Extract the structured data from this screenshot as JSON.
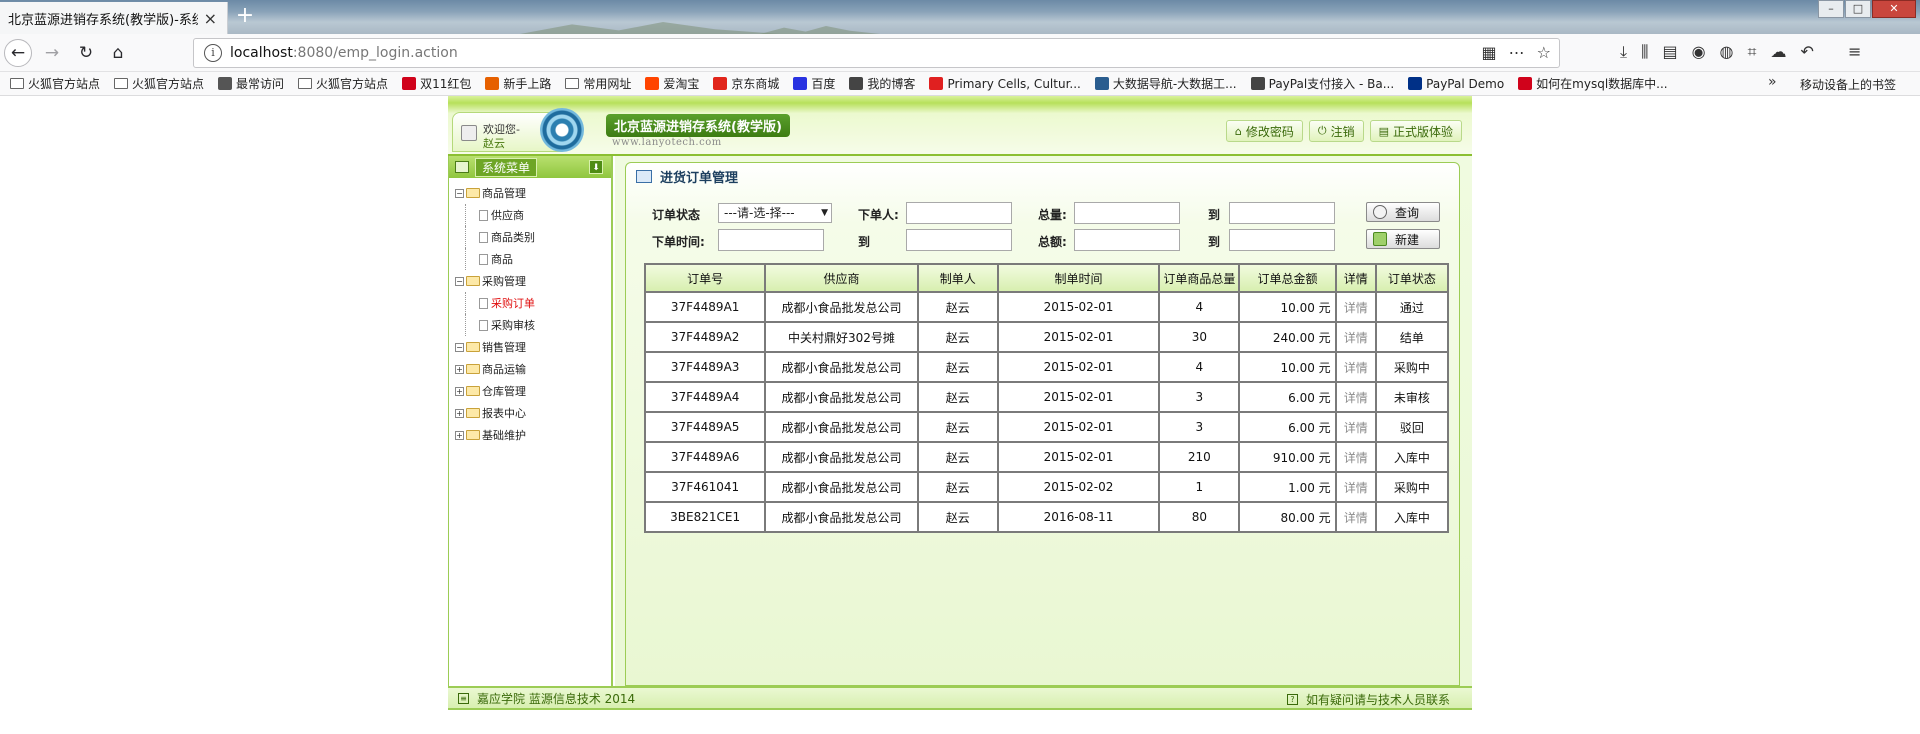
{
  "browser": {
    "tab_title": "北京蓝源进销存系统(教学版)-系统",
    "url_host": "localhost",
    "url_path": ":8080/emp_login.action",
    "bookmarks": [
      {
        "label": "火狐官方站点",
        "icon": "folder",
        "color": "#ffffff"
      },
      {
        "label": "火狐官方站点",
        "icon": "folder",
        "color": "#ffffff"
      },
      {
        "label": "最常访问",
        "icon": "gear",
        "color": "#555555"
      },
      {
        "label": "火狐官方站点",
        "icon": "folder",
        "color": "#ffffff"
      },
      {
        "label": "双11红包",
        "icon": "tmall",
        "color": "#d0021b"
      },
      {
        "label": "新手上路",
        "icon": "firefox",
        "color": "#e66000"
      },
      {
        "label": "常用网址",
        "icon": "folder",
        "color": "#ffffff"
      },
      {
        "label": "爱淘宝",
        "icon": "taobao",
        "color": "#ff4400"
      },
      {
        "label": "京东商城",
        "icon": "jd",
        "color": "#e1251b"
      },
      {
        "label": "百度",
        "icon": "baidu",
        "color": "#2932e1"
      },
      {
        "label": "我的博客",
        "icon": "blog",
        "color": "#444444"
      },
      {
        "label": "Primary Cells, Cultur...",
        "icon": "circle",
        "color": "#e02020"
      },
      {
        "label": "大数据导航-大数据工...",
        "icon": "bigdata",
        "color": "#2a5d8f"
      },
      {
        "label": "PayPal支付接入 - Ba...",
        "icon": "blog",
        "color": "#444444"
      },
      {
        "label": "PayPal Demo",
        "icon": "paypal",
        "color": "#003087"
      },
      {
        "label": "如何在mysql数据库中...",
        "icon": "csdn",
        "color": "#d0021b"
      }
    ],
    "mobile_bookmarks": "移动设备上的书签"
  },
  "header": {
    "welcome": "欢迎您-",
    "user": "赵云",
    "system_title": "北京蓝源进销存系统(教学版)",
    "site_url": "www.lanyotech.com",
    "buttons": [
      {
        "label": "修改密码",
        "icon": "home-icon"
      },
      {
        "label": "注销",
        "icon": "power-icon"
      },
      {
        "label": "正式版体验",
        "icon": "list-icon"
      }
    ]
  },
  "sidebar": {
    "title": "系统菜单",
    "groups": [
      {
        "label": "商品管理",
        "expanded": true,
        "children": [
          "供应商",
          "商品类别",
          "商品"
        ]
      },
      {
        "label": "采购管理",
        "expanded": true,
        "children": [
          "采购订单",
          "采购审核"
        ]
      },
      {
        "label": "销售管理",
        "expanded": true,
        "children": []
      },
      {
        "label": "商品运输",
        "expanded": false,
        "children": []
      },
      {
        "label": "仓库管理",
        "expanded": false,
        "children": []
      },
      {
        "label": "报表中心",
        "expanded": false,
        "children": []
      },
      {
        "label": "基础维护",
        "expanded": false,
        "children": []
      }
    ],
    "active_item": "采购订单"
  },
  "panel": {
    "title": "进货订单管理",
    "filters": {
      "status_label": "订单状态",
      "status_value": "---请-选-择---",
      "creator_label": "下单人:",
      "total_qty_label": "总量:",
      "to_label": "到",
      "date_label": "下单时间:",
      "amount_label": "总额:",
      "creator_value": "",
      "date_from": "",
      "date_to": "",
      "qty_from": "",
      "qty_to": "",
      "amount_from": "",
      "amount_to": ""
    },
    "search_button": "查询",
    "new_button": "新建"
  },
  "table": {
    "columns": [
      "订单号",
      "供应商",
      "制单人",
      "制单时间",
      "订单商品总量",
      "订单总金额",
      "详情",
      "订单状态"
    ],
    "rows": [
      [
        "37F4489A1",
        "成都小食品批发总公司",
        "赵云",
        "2015-02-01",
        "4",
        "10.00 元",
        "详情",
        "通过"
      ],
      [
        "37F4489A2",
        "中关村鼎好302号摊",
        "赵云",
        "2015-02-01",
        "30",
        "240.00 元",
        "详情",
        "结单"
      ],
      [
        "37F4489A3",
        "成都小食品批发总公司",
        "赵云",
        "2015-02-01",
        "4",
        "10.00 元",
        "详情",
        "采购中"
      ],
      [
        "37F4489A4",
        "成都小食品批发总公司",
        "赵云",
        "2015-02-01",
        "3",
        "6.00 元",
        "详情",
        "未审核"
      ],
      [
        "37F4489A5",
        "成都小食品批发总公司",
        "赵云",
        "2015-02-01",
        "3",
        "6.00 元",
        "详情",
        "驳回"
      ],
      [
        "37F4489A6",
        "成都小食品批发总公司",
        "赵云",
        "2015-02-01",
        "210",
        "910.00 元",
        "详情",
        "入库中"
      ],
      [
        "37F461041",
        "成都小食品批发总公司",
        "赵云",
        "2015-02-02",
        "1",
        "1.00 元",
        "详情",
        "采购中"
      ],
      [
        "3BE821CE1",
        "成都小食品批发总公司",
        "赵云",
        "2016-08-11",
        "80",
        "80.00 元",
        "详情",
        "入库中"
      ]
    ]
  },
  "footer": {
    "left": "嘉应学院 蓝源信息技术 2014",
    "right": "如有疑问请与技术人员联系"
  },
  "colors": {
    "accent_green": "#8bbf32",
    "active_menu": "#e01010"
  }
}
